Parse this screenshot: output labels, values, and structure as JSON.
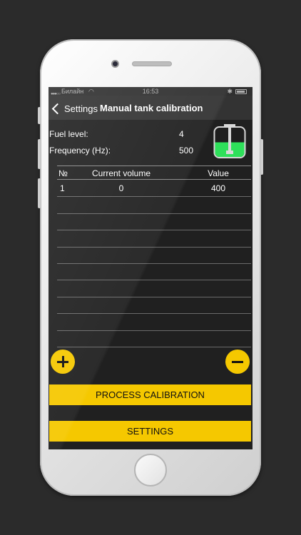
{
  "status_bar": {
    "carrier": "Билайн",
    "time": "16:53"
  },
  "nav": {
    "back_label": "Settings",
    "title": "Manual tank calibration"
  },
  "info": {
    "fuel_level_label": "Fuel level:",
    "fuel_level_value": "4",
    "frequency_label": "Frequency (Hz):",
    "frequency_value": "500",
    "tank_fill_fraction": 0.5
  },
  "table": {
    "headers": [
      "№",
      "Current volume",
      "Value"
    ],
    "rows": [
      [
        "1",
        "0",
        "400"
      ],
      [
        "",
        "",
        ""
      ],
      [
        "",
        "",
        ""
      ],
      [
        "",
        "",
        ""
      ],
      [
        "",
        "",
        ""
      ],
      [
        "",
        "",
        ""
      ],
      [
        "",
        "",
        ""
      ],
      [
        "",
        "",
        ""
      ],
      [
        "",
        "",
        ""
      ],
      [
        "",
        "",
        ""
      ]
    ]
  },
  "buttons": {
    "add_icon": "plus-icon",
    "remove_icon": "minus-icon",
    "process_label": "PROCESS CALIBRATION",
    "settings_label": "SETTINGS"
  },
  "colors": {
    "accent": "#f5c800",
    "tank_fill": "#2ee05a",
    "background": "#2b2b2b"
  }
}
